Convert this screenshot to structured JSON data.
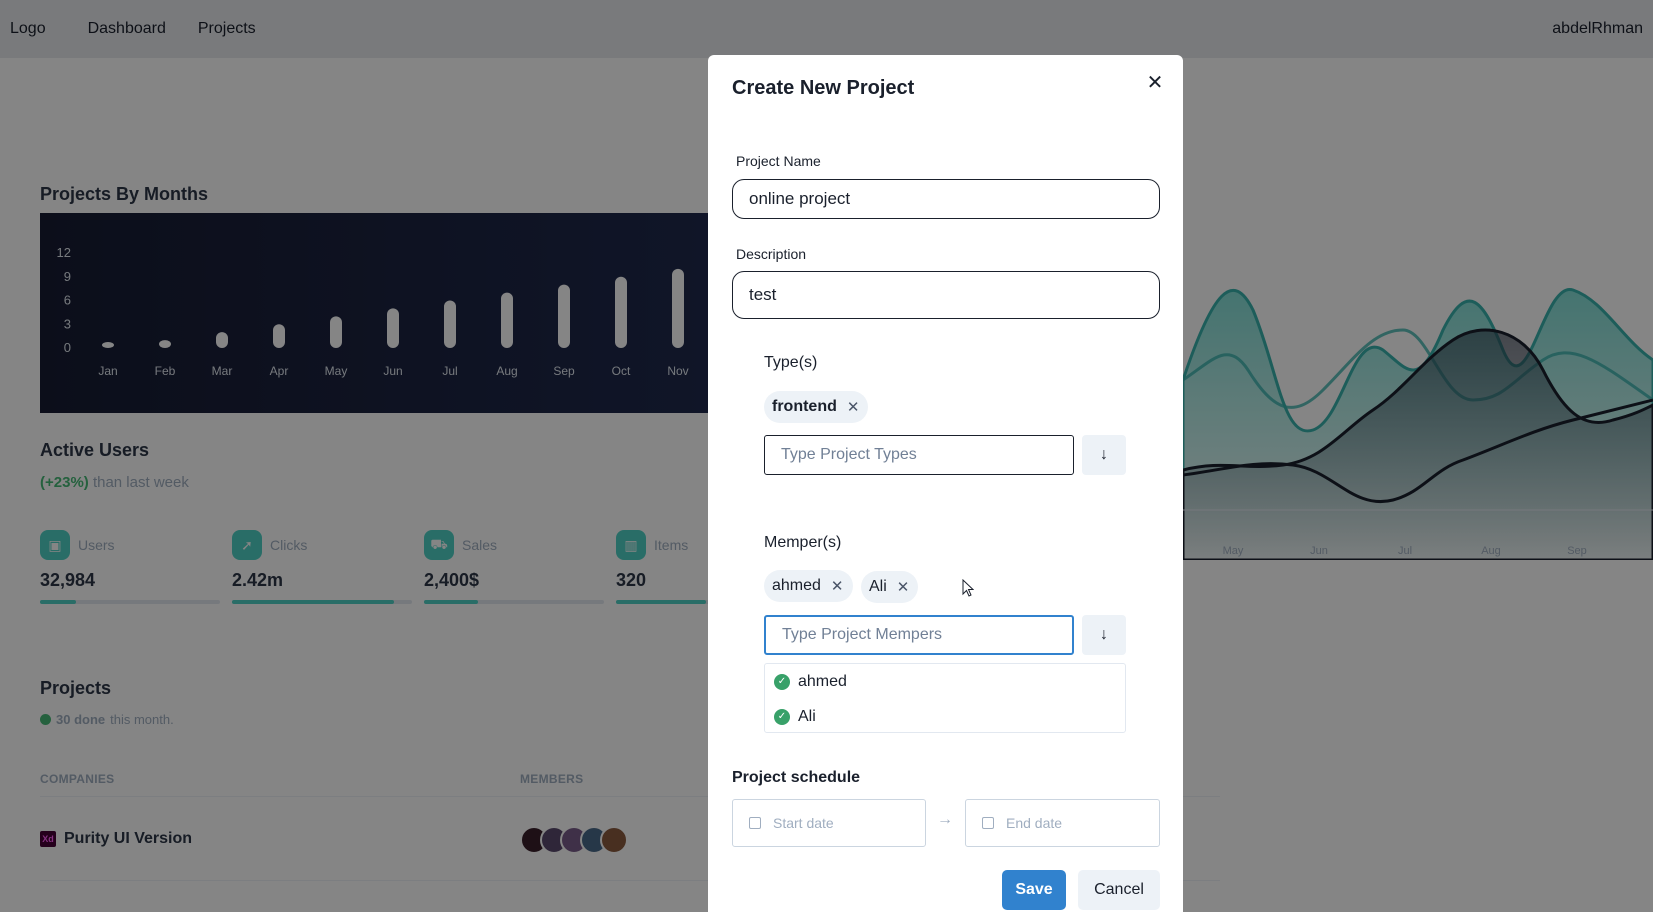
{
  "navbar": {
    "logo": "Logo",
    "links": [
      "Dashboard",
      "Projects"
    ],
    "user": "abdelRhman"
  },
  "projects_by_months": {
    "title": "Projects By Months"
  },
  "chart_data": [
    {
      "type": "bar",
      "title": "Projects By Months",
      "categories": [
        "Jan",
        "Feb",
        "Mar",
        "Apr",
        "May",
        "Jun",
        "Jul",
        "Aug",
        "Sep",
        "Oct",
        "Nov"
      ],
      "values": [
        0.5,
        1,
        2,
        3,
        4,
        5,
        6,
        7,
        8,
        9,
        10
      ],
      "yticks": [
        "0",
        "3",
        "6",
        "9",
        "12"
      ],
      "ylim": [
        0,
        12
      ],
      "grid": false
    },
    {
      "type": "area",
      "categories": [
        "May",
        "Jun",
        "Jul",
        "Aug",
        "Sep"
      ],
      "grid": false
    }
  ],
  "active_users": {
    "title": "Active Users",
    "pct": "(+23%)",
    "suffix": " than last week",
    "stats": [
      {
        "label": "Users",
        "value": "32,984",
        "progress": 0.2,
        "icon": "wallet-icon"
      },
      {
        "label": "Clicks",
        "value": "2.42m",
        "progress": 0.9,
        "icon": "rocket-icon"
      },
      {
        "label": "Sales",
        "value": "2,400$",
        "progress": 0.3,
        "icon": "cart-icon"
      },
      {
        "label": "Items",
        "value": "320",
        "progress": 0.5,
        "icon": "bar-chart-icon"
      }
    ]
  },
  "projects": {
    "title": "Projects",
    "done": "30 done",
    "suffix": " this month.",
    "columns": [
      "COMPANIES",
      "MEMBERS"
    ],
    "rows": [
      {
        "company": "Purity UI Version",
        "icon_text": "Xd"
      }
    ]
  },
  "modal": {
    "title": "Create New Project",
    "close": "✕",
    "project_name_label": "Project Name",
    "project_name_value": "online project",
    "description_label": "Description",
    "description_value": "test",
    "types_label": "Type(s)",
    "types_tags": [
      "frontend"
    ],
    "types_placeholder": "Type Project Types",
    "members_label": "Memper(s)",
    "members_tags": [
      "ahmed",
      "Ali"
    ],
    "members_placeholder": "Type Project Mempers",
    "members_options": [
      "ahmed",
      "Ali"
    ],
    "schedule_label": "Project schedule",
    "start_placeholder": "Start date",
    "end_placeholder": "End date",
    "save": "Save",
    "cancel": "Cancel"
  },
  "colors": {
    "accent": "#4fd1c5",
    "primary": "#3182ce",
    "success": "#48bb78",
    "chart_bg": "#171c33"
  }
}
